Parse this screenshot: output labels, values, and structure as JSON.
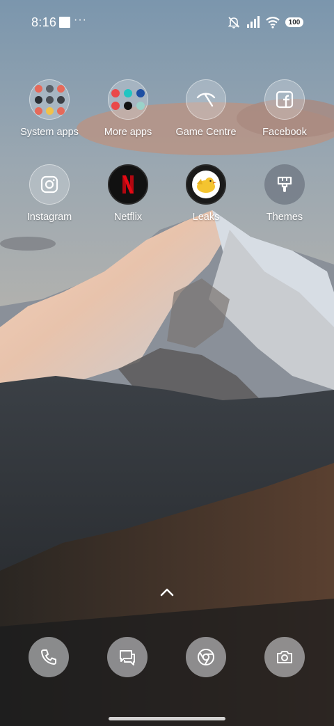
{
  "status_bar": {
    "time": "8:16",
    "more": "···",
    "battery": "100"
  },
  "apps": [
    {
      "label": "System apps"
    },
    {
      "label": "More apps"
    },
    {
      "label": "Game Centre"
    },
    {
      "label": "Facebook"
    },
    {
      "label": "Instagram"
    },
    {
      "label": "Netflix"
    },
    {
      "label": "Leaks"
    },
    {
      "label": "Themes"
    }
  ],
  "dock": {
    "phone_icon": "phone-icon",
    "messages_icon": "messages-icon",
    "browser_icon": "chrome-icon",
    "camera_icon": "camera-icon"
  },
  "colors": {
    "netflix_red": "#e50914",
    "leaks_yellow": "#f4c430"
  }
}
